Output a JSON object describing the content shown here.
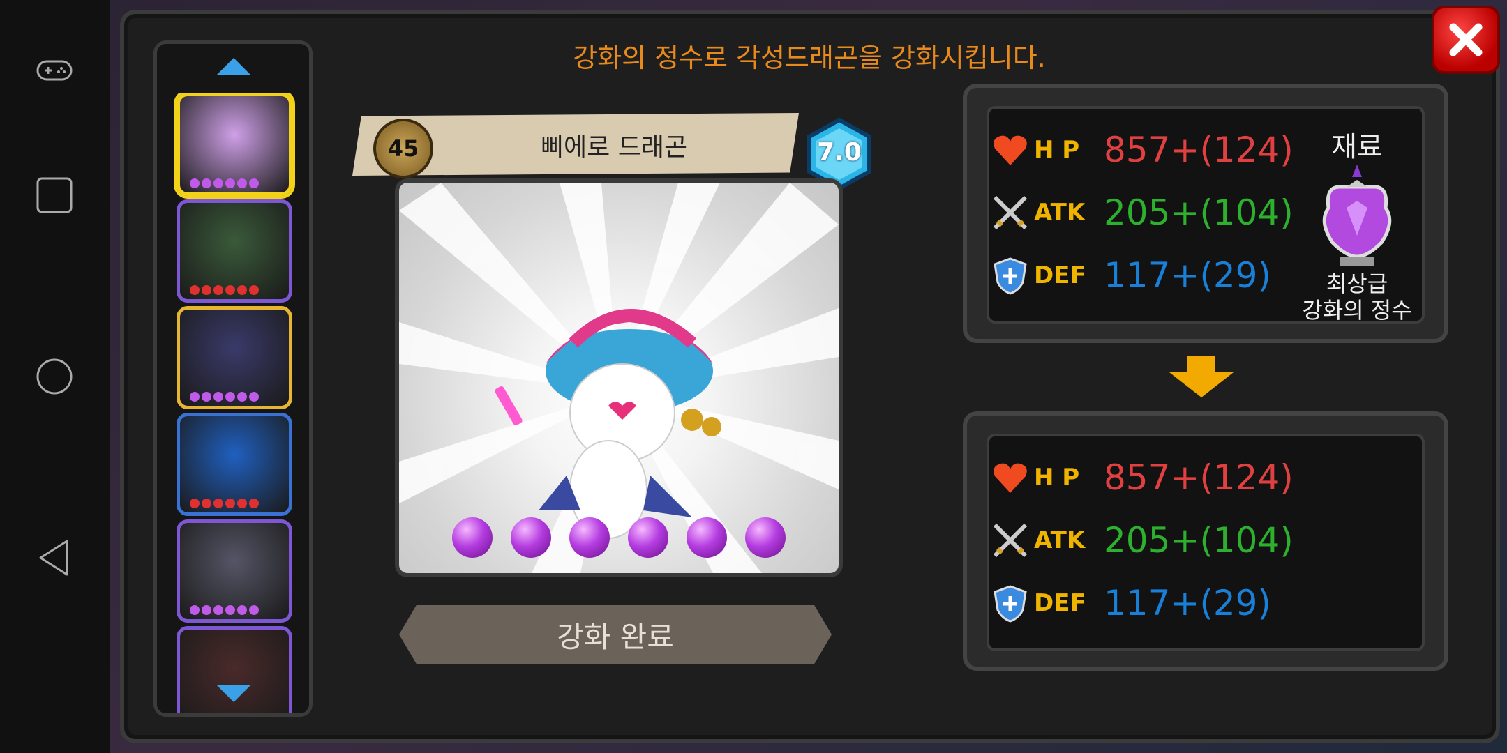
{
  "header": {
    "instruction": "강화의 정수로 각성드래곤을 강화시킵니다."
  },
  "list": {
    "slots": [
      {
        "name": "pierrot-dragon-thumb",
        "border": "#f3d21a",
        "bg": "#cfa0e8",
        "dots": 6,
        "dot_color": "#c05ae8",
        "selected": true
      },
      {
        "name": "dark-spike-dragon-thumb",
        "border": "#7d57d4",
        "bg": "#3a5a3a",
        "dots": 6,
        "dot_color": "#e03030"
      },
      {
        "name": "armored-dragon-thumb",
        "border": "#e6b531",
        "bg": "#3a3a6a",
        "dots": 6,
        "dot_color": "#c05ae8"
      },
      {
        "name": "moon-dragon-thumb",
        "border": "#3a72d4",
        "bg": "#2060c0",
        "dots": 6,
        "dot_color": "#e03030"
      },
      {
        "name": "bandage-dragon-thumb",
        "border": "#7d57d4",
        "bg": "#555566",
        "dots": 6,
        "dot_color": "#c05ae8"
      },
      {
        "name": "shadow-dragon-thumb",
        "border": "#7d57d4",
        "bg": "#4a2a2a",
        "dots": 0,
        "dot_color": "#c05ae8"
      }
    ]
  },
  "dragon": {
    "level": "45",
    "name": "삐에로 드래곤",
    "grade": "7.0",
    "orbs": 6,
    "complete_label": "강화 완료"
  },
  "before": {
    "hp_label": "H P",
    "hp": "857+(124)",
    "atk_label": "ATK",
    "atk": "205+(104)",
    "def_label": "DEF",
    "def": "117+(29)"
  },
  "after": {
    "hp_label": "H P",
    "hp": "857+(124)",
    "atk_label": "ATK",
    "atk": "205+(104)",
    "def_label": "DEF",
    "def": "117+(29)"
  },
  "material": {
    "title": "재료",
    "name_line1": "최상급",
    "name_line2": "강화의 정수"
  },
  "colors": {
    "title": "#e8891c",
    "hp": "#e04040",
    "atk": "#2db02d",
    "def": "#1a7fd6",
    "stat_label": "#f0b400"
  }
}
